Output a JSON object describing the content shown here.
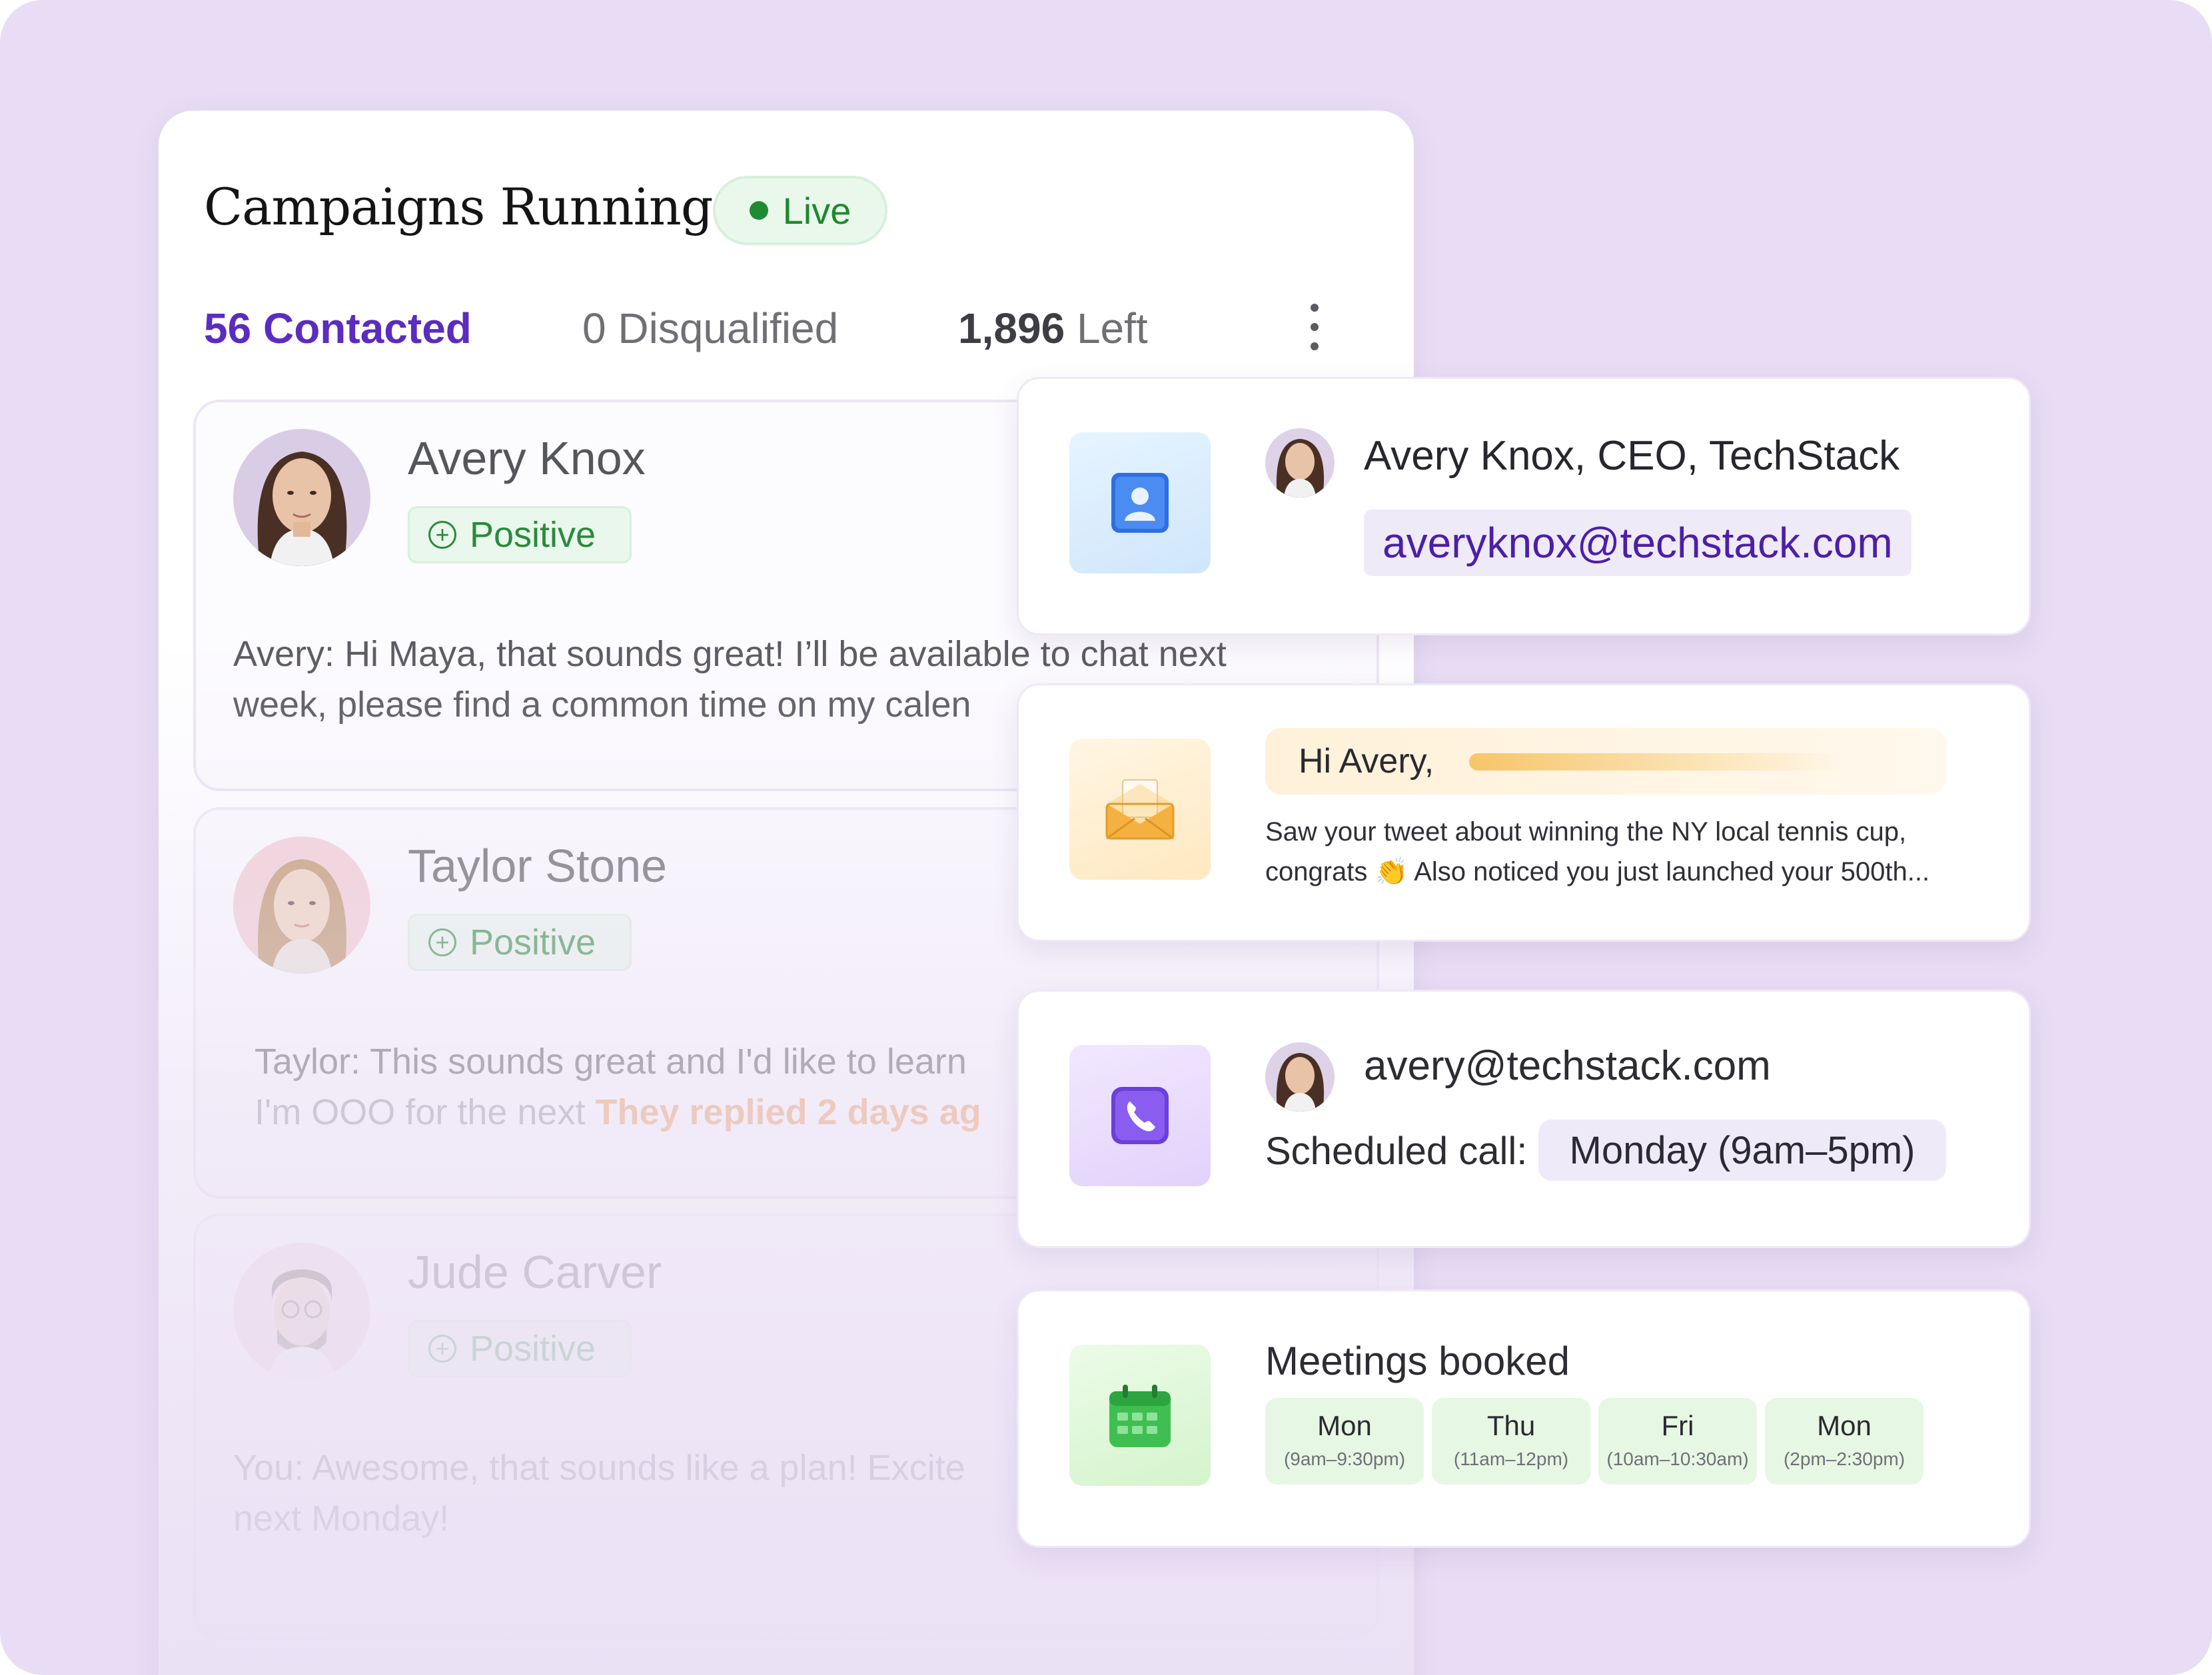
{
  "campaign": {
    "title": "Campaigns Running",
    "status": "Live",
    "stats": {
      "contacted_num": "56",
      "contacted_label": "Contacted",
      "disqualified_num": "0",
      "disqualified_label": "Disqualified",
      "left_num": "1,896",
      "left_label": "Left"
    }
  },
  "leads": [
    {
      "name": "Avery Knox",
      "status": "Positive",
      "message_1": "Avery: Hi Maya, that sounds great! I’ll be available to chat next",
      "message_2": "week, please find a common time on my calen"
    },
    {
      "name": "Taylor Stone",
      "status": "Positive",
      "message_1": "Taylor: This sounds great and I'd like to learn",
      "message_2": "I'm OOO for the next",
      "replied": "They replied 2 days ag"
    },
    {
      "name": "Jude Carver",
      "status": "Positive",
      "message_1": "You: Awesome, that sounds like a plan! Excite",
      "message_2": "next Monday!"
    }
  ],
  "contact_card": {
    "name_line": "Avery Knox, CEO, TechStack",
    "email": "averyknox@techstack.com"
  },
  "email_card": {
    "greeting": "Hi Avery,",
    "snippet_1": "Saw your tweet about winning the NY local tennis cup,",
    "snippet_2": "congrats 👏 Also noticed you just launched your 500th..."
  },
  "call_card": {
    "email": "avery@techstack.com",
    "scheduled_label": "Scheduled call:",
    "scheduled_value": "Monday (9am–5pm)"
  },
  "meetings_card": {
    "title": "Meetings booked",
    "slots": [
      {
        "day": "Mon",
        "time": "(9am–9:30pm)"
      },
      {
        "day": "Thu",
        "time": "(11am–12pm)"
      },
      {
        "day": "Fri",
        "time": "(10am–10:30am)"
      },
      {
        "day": "Mon",
        "time": "(2pm–2:30pm)"
      }
    ]
  },
  "colors": {
    "background": "#e8ddf4",
    "accent_purple": "#5b2cc0",
    "positive_green": "#2a8a3c",
    "replied_orange": "#f0a15f"
  },
  "icons": [
    "more-vertical-icon",
    "contact-book-icon",
    "envelope-icon",
    "phone-icon",
    "calendar-icon",
    "plus-circle-icon"
  ]
}
